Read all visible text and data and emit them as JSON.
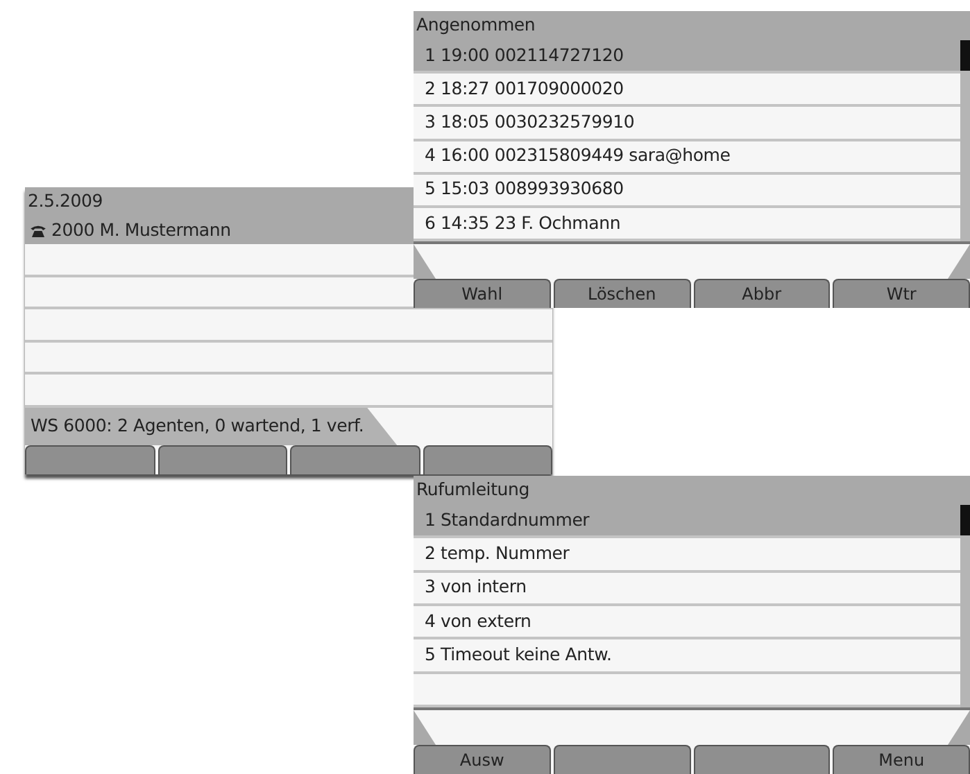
{
  "screens": [
    {
      "kind": "list",
      "title": "Angenommen",
      "rows": [
        {
          "text": "1 19:00  002114727120",
          "selected": true
        },
        {
          "text": "2 18:27  001709000020",
          "selected": false
        },
        {
          "text": "3 18:05  0030232579910",
          "selected": false
        },
        {
          "text": "4 16:00  002315809449 sara@home",
          "selected": false
        },
        {
          "text": "5 15:03  008993930680",
          "selected": false
        },
        {
          "text": "6 14:35  23 F. Ochmann",
          "selected": false
        }
      ],
      "softkeys": [
        {
          "kind": "labeled",
          "label": "Wahl"
        },
        {
          "kind": "labeled",
          "label": "Löschen"
        },
        {
          "kind": "labeled",
          "label": "Abbr"
        },
        {
          "kind": "labeled",
          "label": "Wtr"
        }
      ]
    },
    {
      "kind": "idle",
      "title": "2.5.2009",
      "header": "2000 M. Mustermann",
      "status": "WS 6000: 2 Agenten, 0 wartend, 1 verf.",
      "softkeys": [
        {
          "kind": "blank"
        },
        {
          "kind": "blank"
        },
        {
          "kind": "blank"
        },
        {
          "kind": "blank"
        }
      ]
    },
    {
      "kind": "list",
      "title": "Rufumleitung",
      "rows": [
        {
          "text": "1 Standardnummer",
          "selected": true
        },
        {
          "text": "2 temp. Nummer",
          "selected": false
        },
        {
          "text": "3 von intern",
          "selected": false
        },
        {
          "text": "4 von extern",
          "selected": false
        },
        {
          "text": "5 Timeout keine Antw.",
          "selected": false
        }
      ],
      "softkeys": [
        {
          "kind": "labeled",
          "label": "Ausw"
        },
        {
          "kind": "blank"
        },
        {
          "kind": "blank"
        },
        {
          "kind": "labeled",
          "label": "Menu"
        }
      ]
    }
  ]
}
